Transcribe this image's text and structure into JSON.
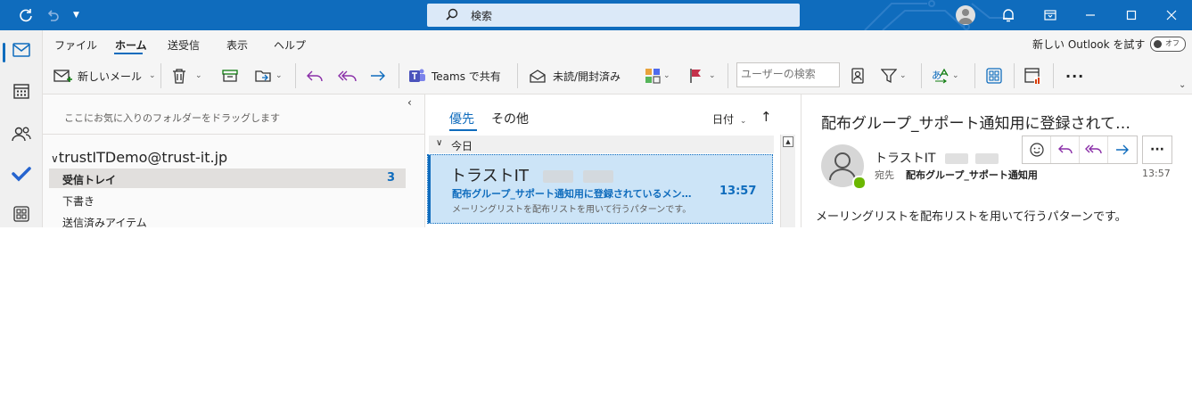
{
  "search": {
    "placeholder": "検索"
  },
  "ribbon": {
    "tabs": [
      "ファイル",
      "ホーム",
      "送受信",
      "表示",
      "ヘルプ"
    ],
    "active_tab": "ホーム",
    "new_outlook_label": "新しい Outlook を試す",
    "toggle_state": "オフ"
  },
  "toolbar": {
    "new_mail": "新しいメール",
    "teams_share": "Teams で共有",
    "unread_read": "未読/開封済み",
    "people_search_placeholder": "ユーザーの検索",
    "more": "···"
  },
  "folder_pane": {
    "favorites_hint": "ここにお気に入りのフォルダーをドラッグします",
    "account": "trustITDemo@trust-it.jp",
    "folders": [
      {
        "name": "受信トレイ",
        "count": "3",
        "selected": true
      },
      {
        "name": "下書き"
      },
      {
        "name": "送信済みアイテム"
      }
    ]
  },
  "message_list": {
    "tabs": [
      "優先",
      "その他"
    ],
    "sort_label": "日付",
    "sort_direction": "↑",
    "group": "今日",
    "items": [
      {
        "sender": "トラストIT",
        "subject": "配布グループ_サポート通知用に登録されているメン…",
        "time": "13:57",
        "preview": "メーリングリストを配布リストを用いて行うパターンです。"
      }
    ]
  },
  "reading_pane": {
    "subject": "配布グループ_サポート通知用に登録されて…",
    "sender": "トラストIT",
    "to_label": "宛先",
    "to": "配布グループ_サポート通知用",
    "time": "13:57",
    "body": "メーリングリストを配布リストを用いて行うパターンです。"
  },
  "colors": {
    "accent": "#0f6cbd",
    "selected_item": "#cce4f7",
    "presence": "#6bb700"
  }
}
